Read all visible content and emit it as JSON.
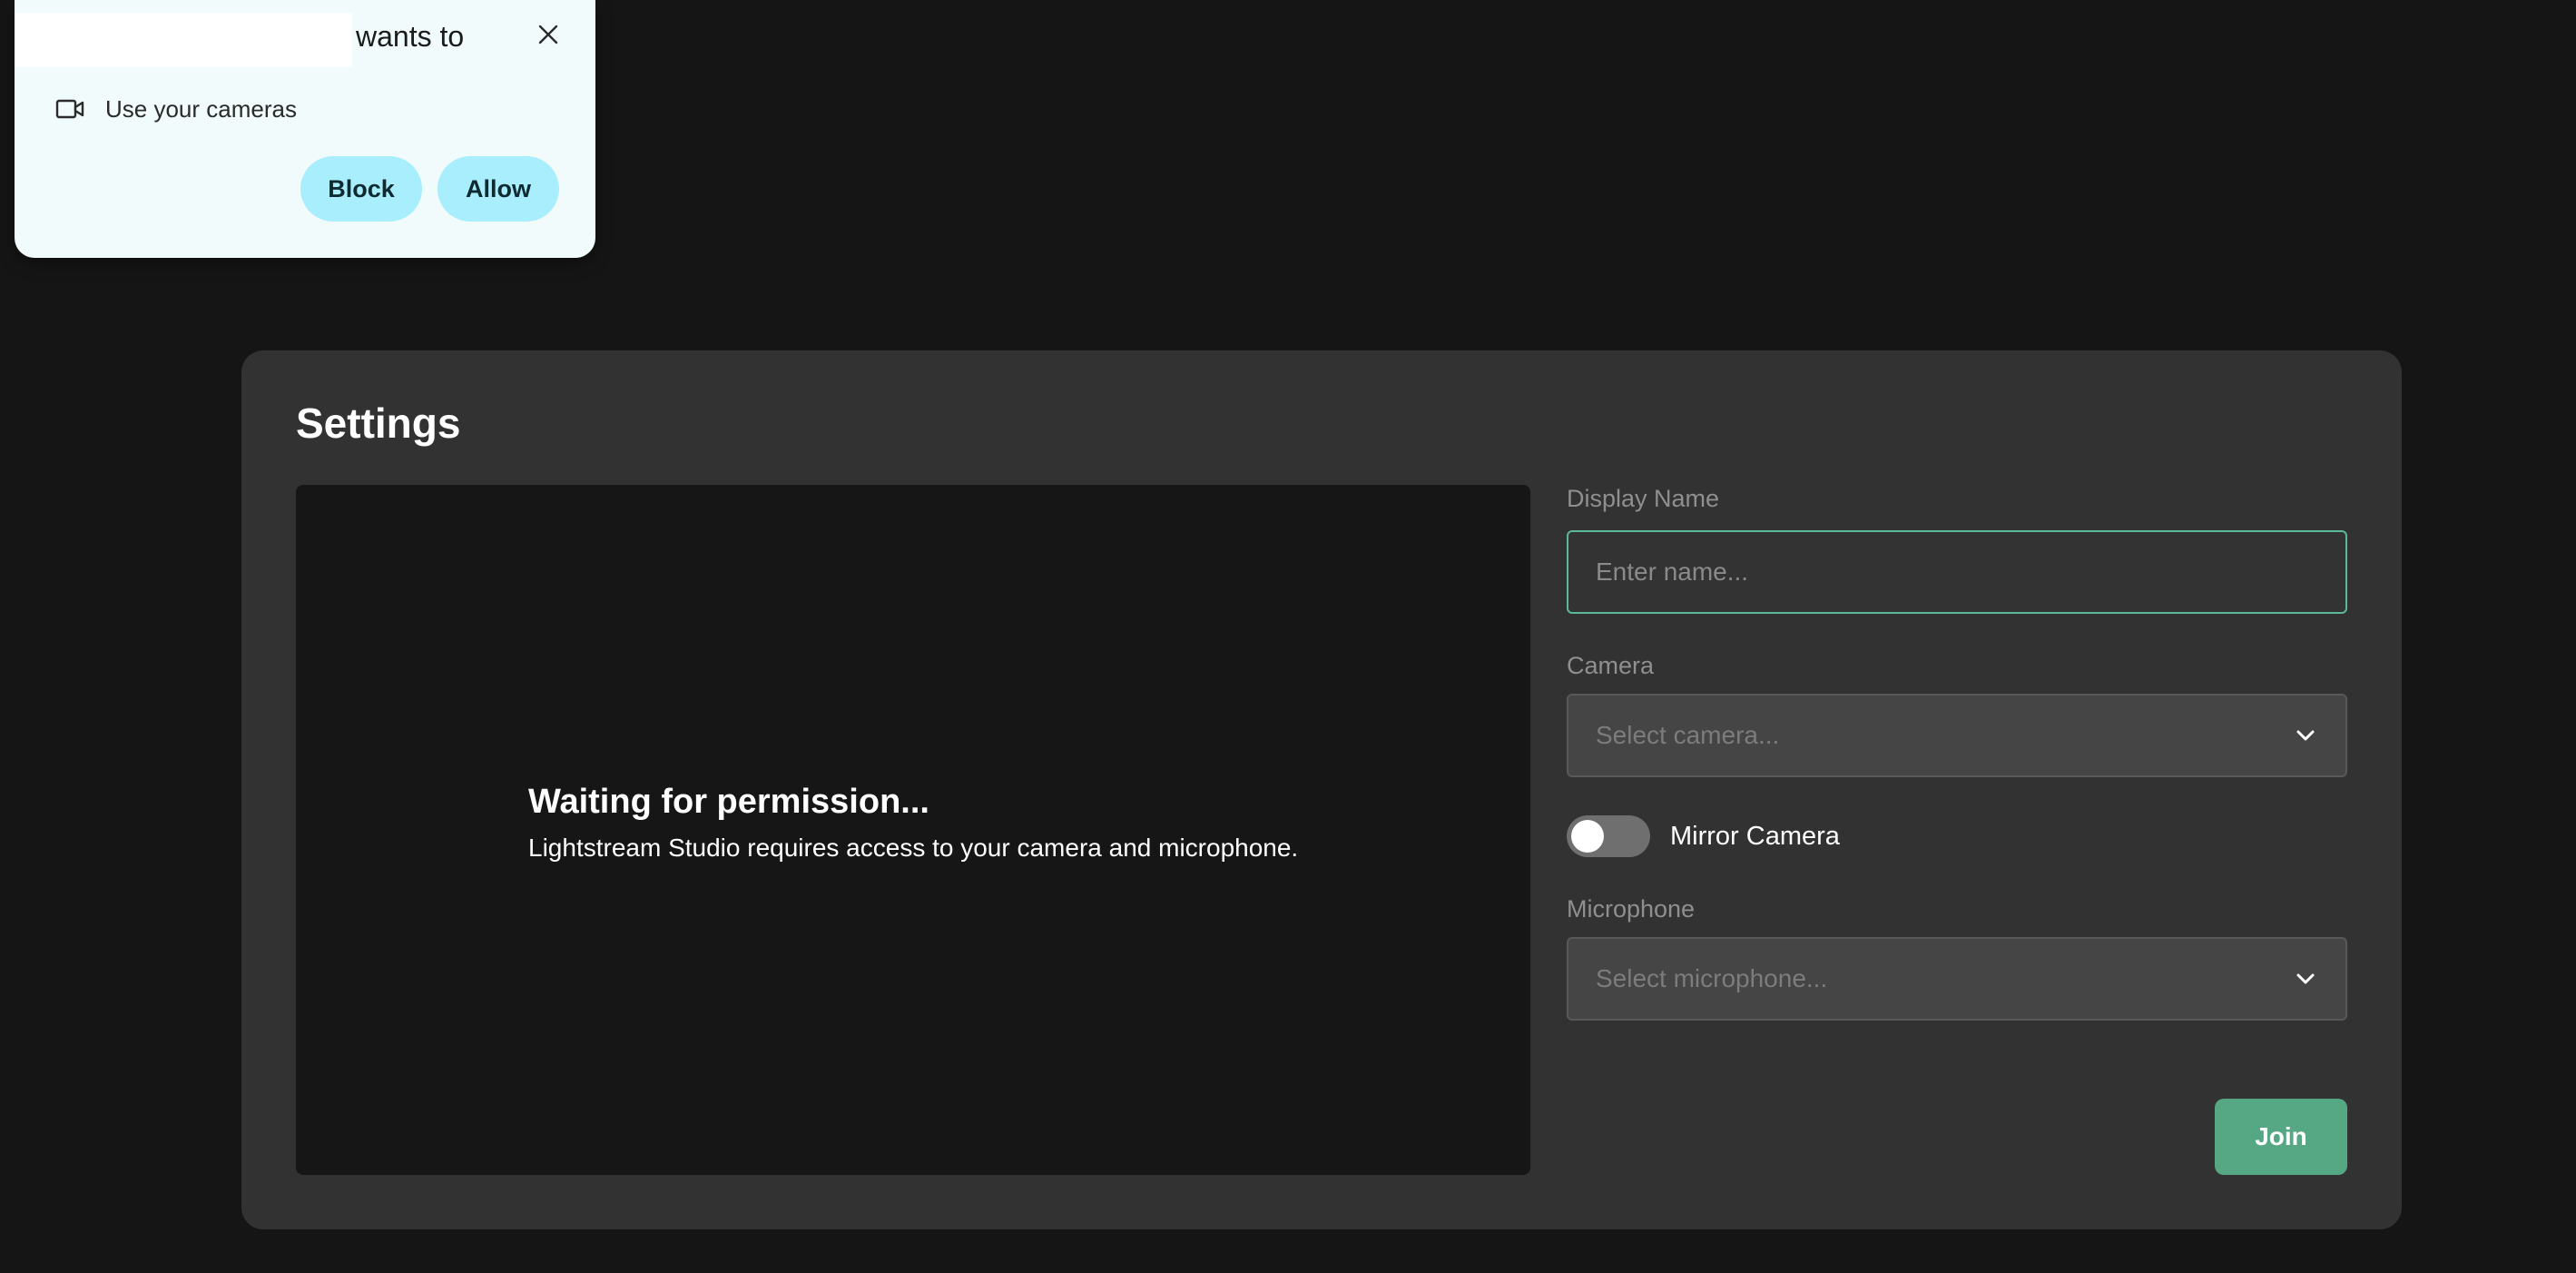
{
  "permission_popup": {
    "wants_text": "wants to",
    "request_label": "Use your cameras",
    "block_label": "Block",
    "allow_label": "Allow",
    "icons": {
      "close": "close-icon",
      "camera": "video-camera-icon"
    },
    "colors": {
      "background": "#f1fbfc",
      "button": "#a8eefc"
    }
  },
  "settings": {
    "title": "Settings",
    "preview": {
      "heading": "Waiting for permission...",
      "message": "Lightstream Studio requires access to your camera and microphone."
    },
    "display_name": {
      "label": "Display Name",
      "placeholder": "Enter name...",
      "value": ""
    },
    "camera": {
      "label": "Camera",
      "placeholder": "Select camera..."
    },
    "mirror_camera": {
      "label": "Mirror Camera",
      "enabled": false
    },
    "microphone": {
      "label": "Microphone",
      "placeholder": "Select microphone..."
    },
    "join_label": "Join",
    "colors": {
      "card": "#323232",
      "accent": "#56a884",
      "input_focus_border": "#5bb89a"
    }
  }
}
